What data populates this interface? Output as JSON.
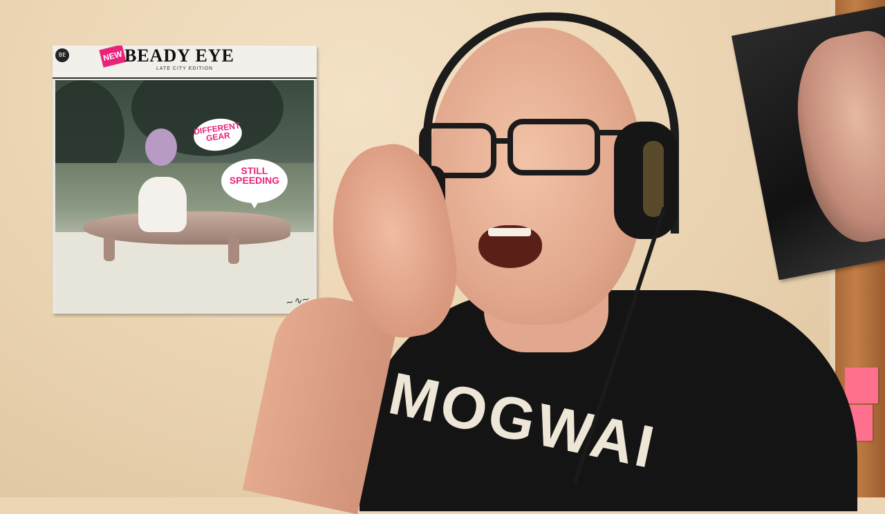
{
  "scene": {
    "wall_color": "#ecd6b6",
    "door_color": "#b87640"
  },
  "album_poster": {
    "label_logo": "BE",
    "label_new": "NEW",
    "title": "BEADY EYE",
    "edition": "LATE CITY EDITION",
    "bubble_1": "DIFFERENT GEAR",
    "bubble_2": "STILL SPEEDING",
    "accent_color": "#e8237a"
  },
  "shirt": {
    "text": "MOGWAI"
  }
}
